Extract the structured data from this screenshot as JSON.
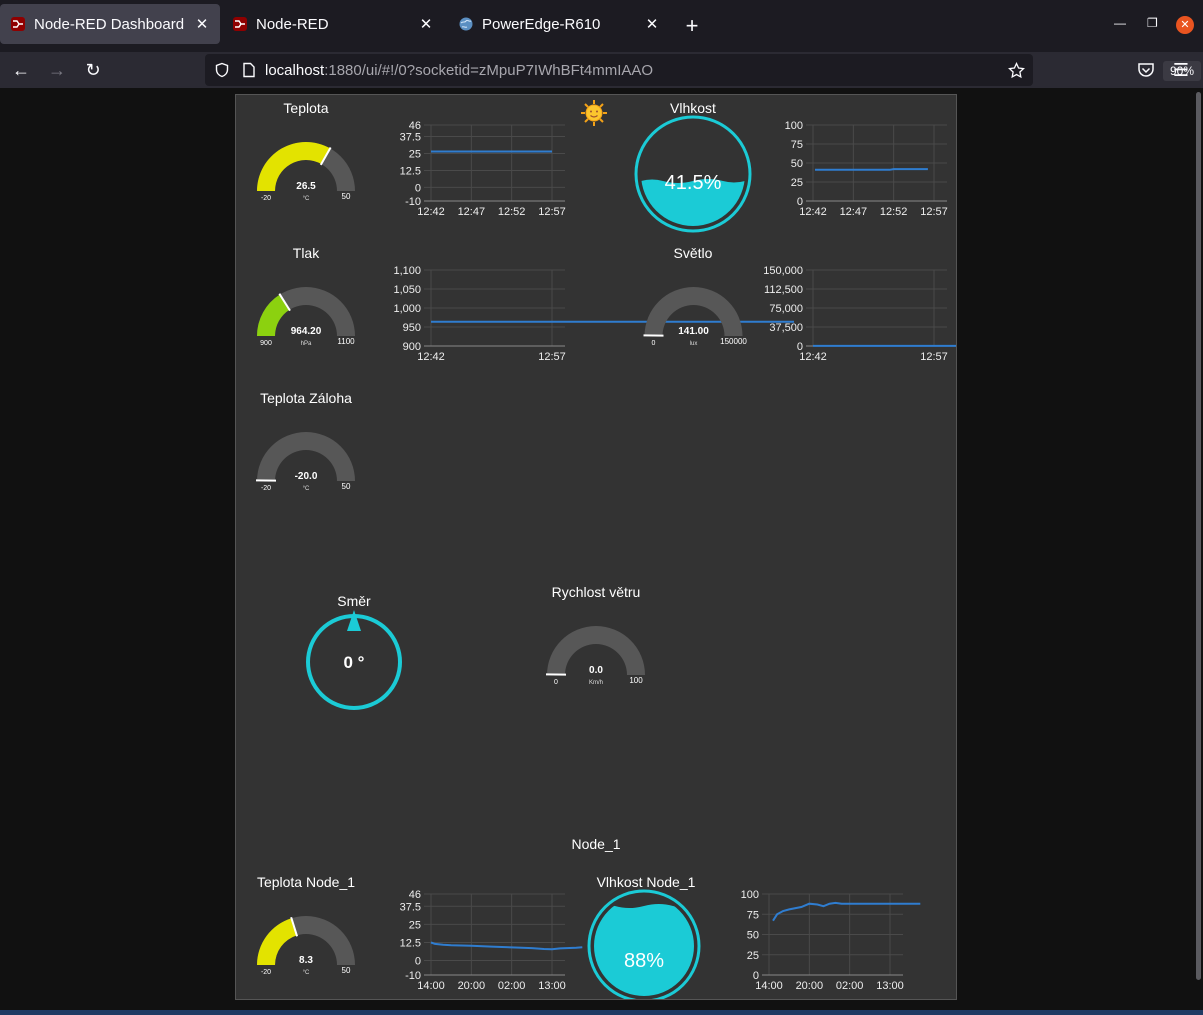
{
  "browser": {
    "tabs": [
      {
        "title": "Node-RED Dashboard",
        "active": true
      },
      {
        "title": "Node-RED",
        "active": false
      },
      {
        "title": "PowerEdge-R610",
        "active": false
      }
    ],
    "url_host": "localhost",
    "url_rest": ":1880/ui/#!/0?socketid=zMpuP7IWhBFt4mmIAAO",
    "zoom": "90%"
  },
  "colors": {
    "accent": "#1bcbd6",
    "gauge_yellow": "#e3e300",
    "gauge_green": "#8cd10f",
    "chart_line": "#2f7dd0",
    "panel_bg": "#333333"
  },
  "widgets": {
    "teplota": {
      "title": "Teplota",
      "value": "26.5",
      "unit": "°C",
      "min": "-20",
      "max": "50",
      "fraction": 0.664
    },
    "vlhkost": {
      "title": "Vlhkost",
      "value": "41.5%"
    },
    "tlak": {
      "title": "Tlak",
      "value": "964.20",
      "unit": "hPa",
      "min": "900",
      "max": "1100",
      "fraction": 0.321
    },
    "svetlo": {
      "title": "Světlo",
      "value": "141.00",
      "unit": "lux",
      "min": "0",
      "max": "150000",
      "fraction": 0.001
    },
    "teplota_zaloha": {
      "title": "Teplota Záloha",
      "value": "-20.0",
      "unit": "°C",
      "min": "-20",
      "max": "50",
      "fraction": 0.0
    },
    "smer": {
      "title": "Směr",
      "value": "0 °"
    },
    "rychlost": {
      "title": "Rychlost větru",
      "value": "0.0",
      "unit": "Km/h",
      "min": "0",
      "max": "100",
      "fraction": 0.0
    },
    "group_node1": "Node_1",
    "teplota_node1": {
      "title": "Teplota Node_1",
      "value": "8.3",
      "unit": "°C",
      "min": "-20",
      "max": "50",
      "fraction": 0.404
    },
    "vlhkost_node1": {
      "title": "Vlhkost Node_1",
      "value": "88%"
    }
  },
  "chart_data": [
    {
      "type": "line",
      "name": "teplota-chart",
      "yticks": [
        "-10",
        "0",
        "12.5",
        "25",
        "37.5",
        "46"
      ],
      "ylim": [
        -10,
        46
      ],
      "xticks": [
        "12:42",
        "12:47",
        "12:52",
        "12:57"
      ],
      "series": [
        {
          "x": [
            0,
            3
          ],
          "values": [
            26.5,
            26.5
          ]
        }
      ]
    },
    {
      "type": "line",
      "name": "vlhkost-chart",
      "yticks": [
        "0",
        "25",
        "50",
        "75",
        "100"
      ],
      "ylim": [
        0,
        100
      ],
      "xticks": [
        "12:42",
        "12:47",
        "12:52",
        "12:57"
      ],
      "series": [
        {
          "x": [
            0.05,
            1.9,
            2.0,
            2.85
          ],
          "values": [
            41,
            41,
            42,
            42
          ]
        }
      ]
    },
    {
      "type": "line",
      "name": "tlak-chart",
      "yticks": [
        "900",
        "950",
        "1,000",
        "1,050",
        "1,100"
      ],
      "ylim": [
        900,
        1100
      ],
      "xticks": [
        "12:42",
        "12:57"
      ],
      "series": [
        {
          "x": [
            0,
            3
          ],
          "values": [
            964,
            964
          ]
        }
      ]
    },
    {
      "type": "line",
      "name": "svetlo-chart",
      "yticks": [
        "0",
        "37,500",
        "75,000",
        "112,500",
        "150,000"
      ],
      "ylim": [
        0,
        150000
      ],
      "xticks": [
        "12:42",
        "12:57"
      ],
      "series": [
        {
          "x": [
            0,
            3
          ],
          "values": [
            141,
            141
          ]
        }
      ]
    },
    {
      "type": "line",
      "name": "teplota-node1-chart",
      "yticks": [
        "-10",
        "0",
        "12.5",
        "25",
        "37.5",
        "46"
      ],
      "ylim": [
        -10,
        46
      ],
      "xticks": [
        "14:00",
        "20:00",
        "02:00",
        "13:00"
      ],
      "series": [
        {
          "x": [
            0,
            0.1,
            0.3,
            0.5,
            1.0,
            1.5,
            2.0,
            2.5,
            2.8,
            3.0,
            3.2,
            3.6,
            3.75
          ],
          "values": [
            12.5,
            11.5,
            10.9,
            10.5,
            10.2,
            9.6,
            9.1,
            8.6,
            8.0,
            7.8,
            8.4,
            8.9,
            9.2
          ]
        }
      ]
    },
    {
      "type": "line",
      "name": "vlhkost-node1-chart",
      "yticks": [
        "0",
        "25",
        "50",
        "75",
        "100"
      ],
      "ylim": [
        0,
        100
      ],
      "xticks": [
        "14:00",
        "20:00",
        "02:00",
        "13:00"
      ],
      "series": [
        {
          "x": [
            0.1,
            0.2,
            0.35,
            0.5,
            0.8,
            1.0,
            1.2,
            1.35,
            1.5,
            1.65,
            1.8,
            2.0,
            2.5,
            3.0,
            3.75
          ],
          "values": [
            67,
            75,
            79,
            81,
            84,
            88,
            87,
            85,
            88,
            89,
            88,
            88,
            88,
            88,
            88
          ]
        }
      ]
    }
  ]
}
